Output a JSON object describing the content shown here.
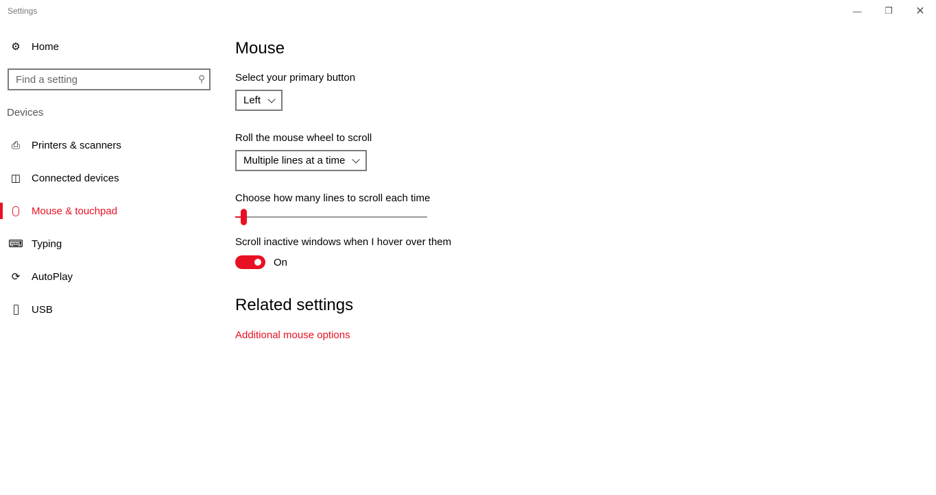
{
  "window": {
    "title": "Settings",
    "minimize_icon": "minimize-icon",
    "maximize_icon": "restore-icon",
    "close_icon": "close-icon"
  },
  "sidebar": {
    "home": {
      "label": "Home",
      "icon": "gear-icon"
    },
    "search": {
      "placeholder": "Find a setting",
      "icon": "search-icon"
    },
    "group": "Devices",
    "items": [
      {
        "label": "Printers & scanners",
        "icon": "printer-icon"
      },
      {
        "label": "Connected devices",
        "icon": "connected-devices-icon"
      },
      {
        "label": "Mouse & touchpad",
        "icon": "mouse-icon",
        "active": true
      },
      {
        "label": "Typing",
        "icon": "keyboard-icon"
      },
      {
        "label": "AutoPlay",
        "icon": "autoplay-icon"
      },
      {
        "label": "USB",
        "icon": "usb-icon"
      }
    ]
  },
  "main": {
    "title": "Mouse",
    "primary_button": {
      "label": "Select your primary button",
      "value": "Left"
    },
    "wheel": {
      "label": "Roll the mouse wheel to scroll",
      "value": "Multiple lines at a time"
    },
    "lines": {
      "label": "Choose how many lines to scroll each time",
      "value_fraction": 0.03
    },
    "inactive": {
      "label": "Scroll inactive windows when I hover over them",
      "state": "On",
      "on": true
    },
    "related": {
      "title": "Related settings",
      "link": "Additional mouse options"
    }
  },
  "colors": {
    "accent": "#e81123"
  }
}
